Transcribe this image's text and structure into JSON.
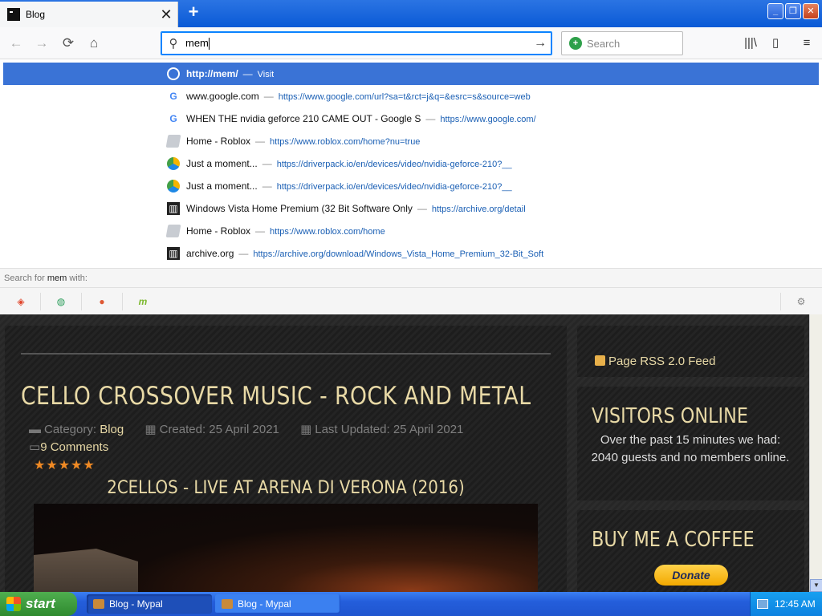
{
  "window": {
    "tab_title": "Blog",
    "tab_close": "✕",
    "new_tab": "+",
    "min": "_",
    "max": "❐",
    "close": "✕"
  },
  "navbar": {
    "url_text": "mem",
    "search_placeholder": "Search"
  },
  "popup": {
    "rows": [
      {
        "icon": "globe-icon",
        "title": "http://mem/",
        "sep": "—",
        "url": "Visit"
      },
      {
        "icon": "google-icon",
        "title": "www.google.com",
        "sep": "—",
        "url": "https://www.google.com/url?sa=t&rct=j&q=&esrc=s&source=web"
      },
      {
        "icon": "google-icon",
        "title": "WHEN THE nvidia geforce 210 CAME OUT - Google S",
        "sep": "—",
        "url": "https://www.google.com/"
      },
      {
        "icon": "roblox-icon",
        "title": "Home - Roblox",
        "sep": "—",
        "url": "https://www.roblox.com/home?nu=true"
      },
      {
        "icon": "driverpack-icon",
        "title": "Just a moment...",
        "sep": "—",
        "url": "https://driverpack.io/en/devices/video/nvidia-geforce-210?__"
      },
      {
        "icon": "driverpack-icon",
        "title": "Just a moment...",
        "sep": "—",
        "url": "https://driverpack.io/en/devices/video/nvidia-geforce-210?__"
      },
      {
        "icon": "archive-icon",
        "title": "Windows Vista Home Premium (32 Bit Software Only",
        "sep": "—",
        "url": "https://archive.org/detail"
      },
      {
        "icon": "roblox-icon",
        "title": "Home - Roblox",
        "sep": "—",
        "url": "https://www.roblox.com/home"
      },
      {
        "icon": "archive-icon",
        "title": "archive.org",
        "sep": "—",
        "url": "https://archive.org/download/Windows_Vista_Home_Premium_32-Bit_Soft"
      }
    ],
    "search_for_prefix": "Search for",
    "search_for_term": "mem",
    "search_for_suffix": "with:"
  },
  "page": {
    "article_title": "CELLO CROSSOVER MUSIC - ROCK AND METAL",
    "category_label": "Category:",
    "category_value": "Blog",
    "created": "Created: 25 April 2021",
    "updated": "Last Updated: 25 April 2021",
    "comments": "9 Comments",
    "stars": "★★★★★",
    "rating": 5,
    "video_title": "2CELLOS - LIVE AT ARENA DI VERONA (2016)",
    "rss_label": "Page RSS 2.0 Feed",
    "visitors_title": "VISITORS ONLINE",
    "visitors_body": "Over the past 15 minutes we had: 2040 guests and no members online.",
    "coffee_title": "BUY ME A COFFEE",
    "donate_label": "Donate"
  },
  "taskbar": {
    "start_label": "start",
    "tasks": [
      {
        "label": "Blog - Mypal",
        "active": true
      },
      {
        "label": "Blog - Mypal",
        "active": false
      }
    ],
    "clock": "12:45 AM"
  },
  "colors": {
    "accent": "#0a84ff",
    "selected_row": "#3a73d6",
    "title_gold": "#e8d9a6",
    "xp_taskbar": "#245edb",
    "xp_start": "#2e8a2e"
  }
}
